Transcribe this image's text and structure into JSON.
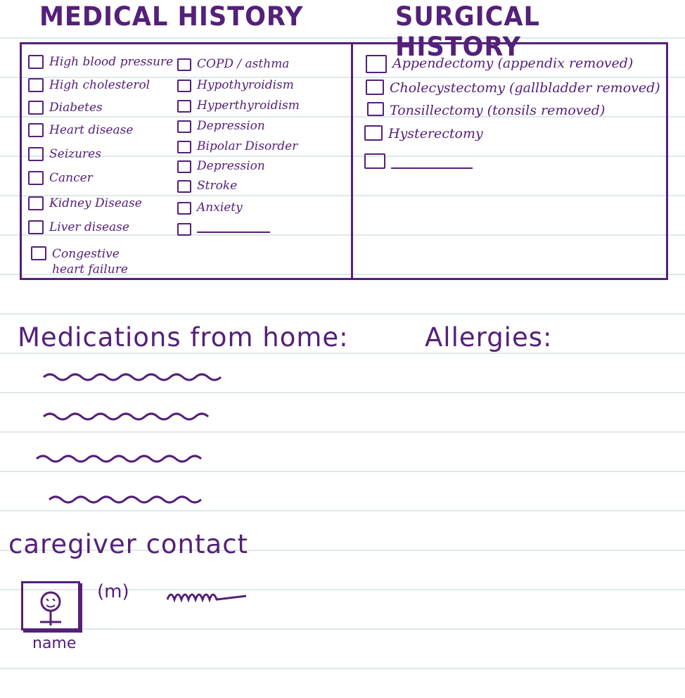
{
  "headings": {
    "medical": "MEDICAL HISTORY",
    "surgical": "SURGICAL HISTORY"
  },
  "medical_col1": [
    "High blood pressure",
    "High cholesterol",
    "Diabetes",
    "Heart disease",
    "Seizures",
    "Cancer",
    "Kidney Disease",
    "Liver disease",
    "Congestive heart failure"
  ],
  "medical_col2": [
    "COPD / asthma",
    "Hypothyroidism",
    "Hyperthyroidism",
    "Depression",
    "Bipolar Disorder",
    "Depression",
    "Stroke",
    "Anxiety"
  ],
  "surgical": [
    "Appendectomy (appendix removed)",
    "Cholecystectomy (gallbladder removed)",
    "Tonsillectomy (tonsils removed)",
    "Hysterectomy"
  ],
  "sections": {
    "medications": "Medications from home:",
    "allergies": "Allergies:",
    "caregiver": "caregiver contact"
  },
  "caregiver": {
    "phone_prefix": "(m)",
    "name_label": "name",
    "avatar_icon": "person-icon"
  },
  "colors": {
    "ink": "#54207a",
    "ruled_line": "#dfe9ea",
    "paper": "#ffffff"
  }
}
